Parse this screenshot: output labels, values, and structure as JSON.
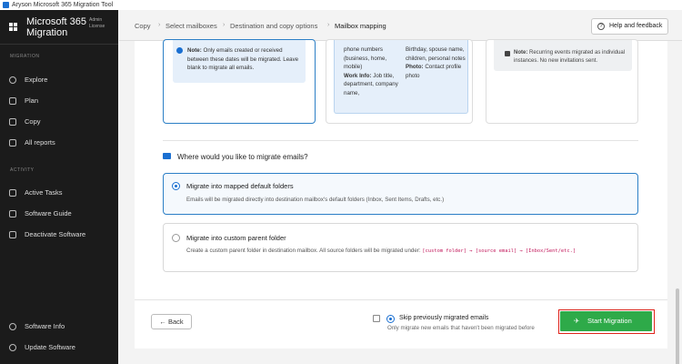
{
  "window": {
    "title": "Aryson Microsoft 365 Migration Tool"
  },
  "brand": {
    "title": "Microsoft 365 Migration",
    "license": "Admin License"
  },
  "sidebar": {
    "migration_label": "MIGRATION",
    "activity_label": "ACTIVITY",
    "migration_items": [
      {
        "label": "Explore",
        "icon": "explore-icon"
      },
      {
        "label": "Plan",
        "icon": "plan-icon"
      },
      {
        "label": "Copy",
        "icon": "copy-icon"
      },
      {
        "label": "All reports",
        "icon": "reports-icon"
      }
    ],
    "activity_items": [
      {
        "label": "Active Tasks",
        "icon": "tasks-icon"
      },
      {
        "label": "Software Guide",
        "icon": "guide-icon"
      },
      {
        "label": "Deactivate Software",
        "icon": "deactivate-icon"
      }
    ],
    "bottom_items": [
      {
        "label": "Software Info",
        "icon": "info-icon"
      },
      {
        "label": "Update Software",
        "icon": "update-icon"
      }
    ]
  },
  "breadcrumb": [
    "Copy",
    "Select mailboxes",
    "Destination and copy options",
    "Mailbox mapping"
  ],
  "help_button": "Help and feedback",
  "cards": {
    "date_note_label": "Note:",
    "date_note": "Only emails created or received between these dates will be migrated. Leave blank to migrate all emails.",
    "contacts_col1_top": "phone numbers (business, home, mobile)",
    "contacts_col1_label": "Work Info:",
    "contacts_col1_text": "Job title, department, company name,",
    "contacts_col2_top": "Birthday, spouse name, children, personal notes",
    "contacts_col2_label": "Photo:",
    "contacts_col2_text": "Contact profile photo",
    "calendar_note_label": "Note:",
    "calendar_note": "Recurring events migrated as individual instances. No new invitations sent."
  },
  "question": "Where would you like to migrate emails?",
  "options": [
    {
      "title": "Migrate into mapped default folders",
      "desc": "Emails will be migrated directly into destination mailbox's default folders (Inbox, Sent Items, Drafts, etc.)",
      "selected": true
    },
    {
      "title": "Migrate into custom parent folder",
      "desc": "Create a custom parent folder in destination mailbox. All source folders will be migrated under:",
      "code": "[custom folder] → [source email] → [Inbox/Sent/etc.]",
      "selected": false
    }
  ],
  "footer": {
    "back": "← Back",
    "skip_title": "Skip previously migrated emails",
    "skip_desc": "Only migrate new emails that haven't been migrated before",
    "start_icon": "✈",
    "start": "Start Migration"
  },
  "colors": {
    "accent": "#1a6fd1",
    "start": "#2eaa49",
    "highlight": "#e0241b",
    "sidebar": "#1b1b1b"
  }
}
